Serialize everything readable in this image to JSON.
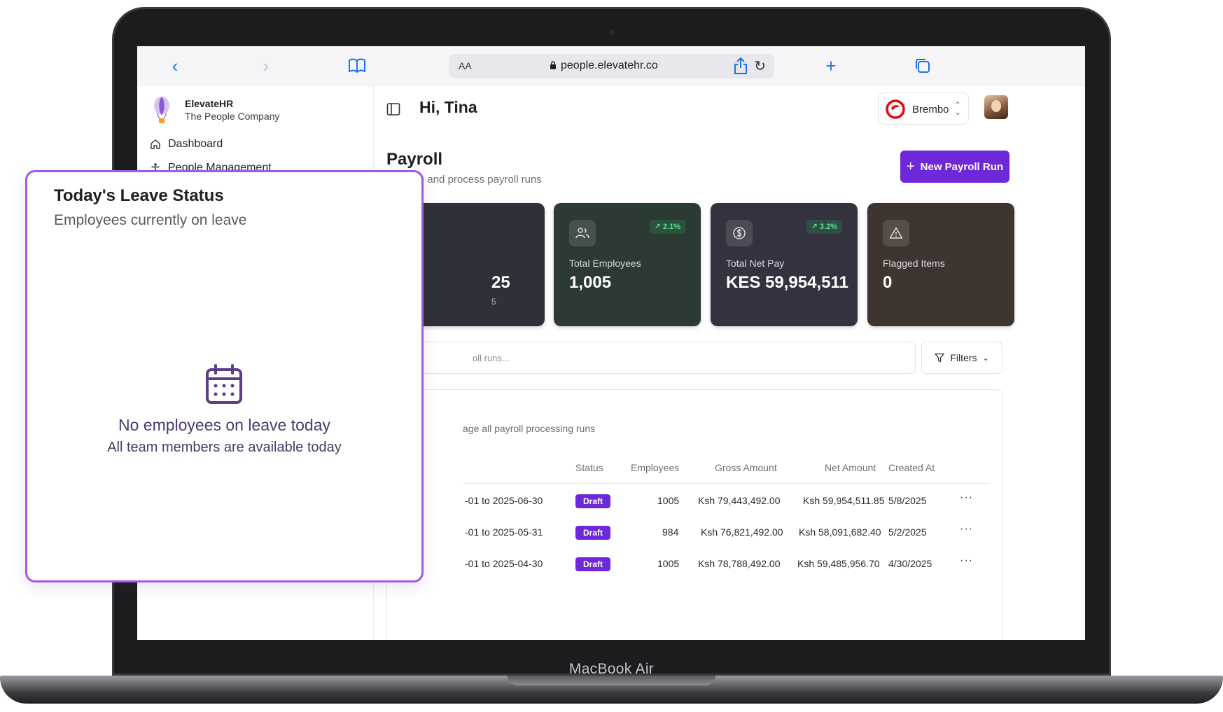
{
  "device": {
    "label": "MacBook Air"
  },
  "browser": {
    "aa_label": "AA",
    "url": "people.elevatehr.co"
  },
  "sidebar": {
    "brand_name": "ElevateHR",
    "brand_tagline": "The People Company",
    "items": [
      {
        "label": "Dashboard",
        "icon": "home-icon"
      },
      {
        "label": "People Management",
        "icon": "person-icon"
      }
    ]
  },
  "header": {
    "greeting": "Hi, Tina",
    "tenant": "Brembo"
  },
  "page": {
    "title": "Payroll",
    "subtitle": "Manage and process payroll runs",
    "new_button": "New Payroll Run"
  },
  "stats": [
    {
      "label": "",
      "value": "25",
      "sub": "5",
      "badge": "",
      "color": "#2e3138"
    },
    {
      "label": "Total Employees",
      "value": "1,005",
      "badge": "↗ 2.1%",
      "icon": "users-icon",
      "color": "#2c3a34"
    },
    {
      "label": "Total Net Pay",
      "value": "KES 59,954,511",
      "badge": "↗ 3.2%",
      "icon": "dollar-icon",
      "color": "#35323f"
    },
    {
      "label": "Flagged Items",
      "value": "0",
      "badge": "",
      "icon": "warning-icon",
      "color": "#3f3530"
    }
  ],
  "search": {
    "placeholder": "oll runs..."
  },
  "filters": {
    "label": "Filters"
  },
  "table": {
    "subtitle": "age all payroll processing runs",
    "columns": [
      "Status",
      "Employees",
      "Gross Amount",
      "Net Amount",
      "Created At"
    ],
    "rows": [
      {
        "period": "-01 to 2025-06-30",
        "status": "Draft",
        "employees": "1005",
        "gross": "Ksh 79,443,492.00",
        "net": "Ksh 59,954,511.85",
        "created": "5/8/2025"
      },
      {
        "period": "-01 to 2025-05-31",
        "status": "Draft",
        "employees": "984",
        "gross": "Ksh 76,821,492.00",
        "net": "Ksh 58,091,682.40",
        "created": "5/2/2025"
      },
      {
        "period": "-01 to 2025-04-30",
        "status": "Draft",
        "employees": "1005",
        "gross": "Ksh 78,788,492.00",
        "net": "Ksh 59,485,956.70",
        "created": "4/30/2025"
      }
    ],
    "more_label": "···"
  },
  "leave_card": {
    "title": "Today's Leave Status",
    "subtitle": "Employees currently on leave",
    "empty_title": "No employees on leave today",
    "empty_sub": "All team members are available today"
  },
  "colors": {
    "accent": "#6d28d9",
    "overlay_border": "#9b5de5",
    "success": "#5be08f"
  }
}
